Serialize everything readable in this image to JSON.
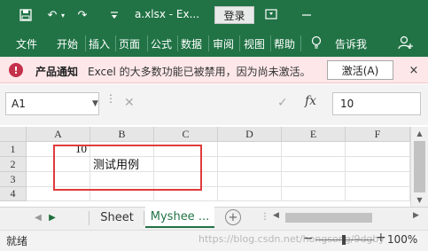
{
  "titlebar": {
    "save_icon": "save-icon",
    "undo_icon": "undo-icon",
    "redo_icon": "redo-icon",
    "customize_icon": "customize-icon",
    "title": "a.xlsx - Ex...",
    "login_label": "登录",
    "restore_icon": "restore-icon",
    "minimize_icon": "minimize-icon"
  },
  "ribbon": {
    "tabs": [
      "文件",
      "开始",
      "插入",
      "页面",
      "公式",
      "数据",
      "审阅",
      "视图",
      "帮助",
      "告诉我"
    ],
    "lightbulb_icon": "lightbulb-icon",
    "share_icon": "share-icon"
  },
  "notice": {
    "title": "产品通知",
    "message": "Excel 的大多数功能已被禁用，因为尚未激活。",
    "activate_label": "激活(A)",
    "close_symbol": "×"
  },
  "formula_bar": {
    "name_box": "A1",
    "fx_label": "fx",
    "value": "10"
  },
  "grid": {
    "columns": [
      "A",
      "B",
      "C",
      "D",
      "E",
      "F"
    ],
    "rows": [
      "1",
      "2",
      "3",
      "4"
    ],
    "cells": {
      "A1": "10",
      "B2": "测试用例"
    }
  },
  "sheets": {
    "tabs": [
      "Sheet",
      "Myshee ..."
    ],
    "active": "Myshee ...",
    "add_symbol": "+"
  },
  "status": {
    "mode": "就绪",
    "watermark": "https://blog.csdn.net/hongsong/9dgby",
    "zoom": "100%"
  },
  "colors": {
    "accent": "#217346",
    "notice_bg": "#fde7e9",
    "highlight": "#e03b3b"
  }
}
